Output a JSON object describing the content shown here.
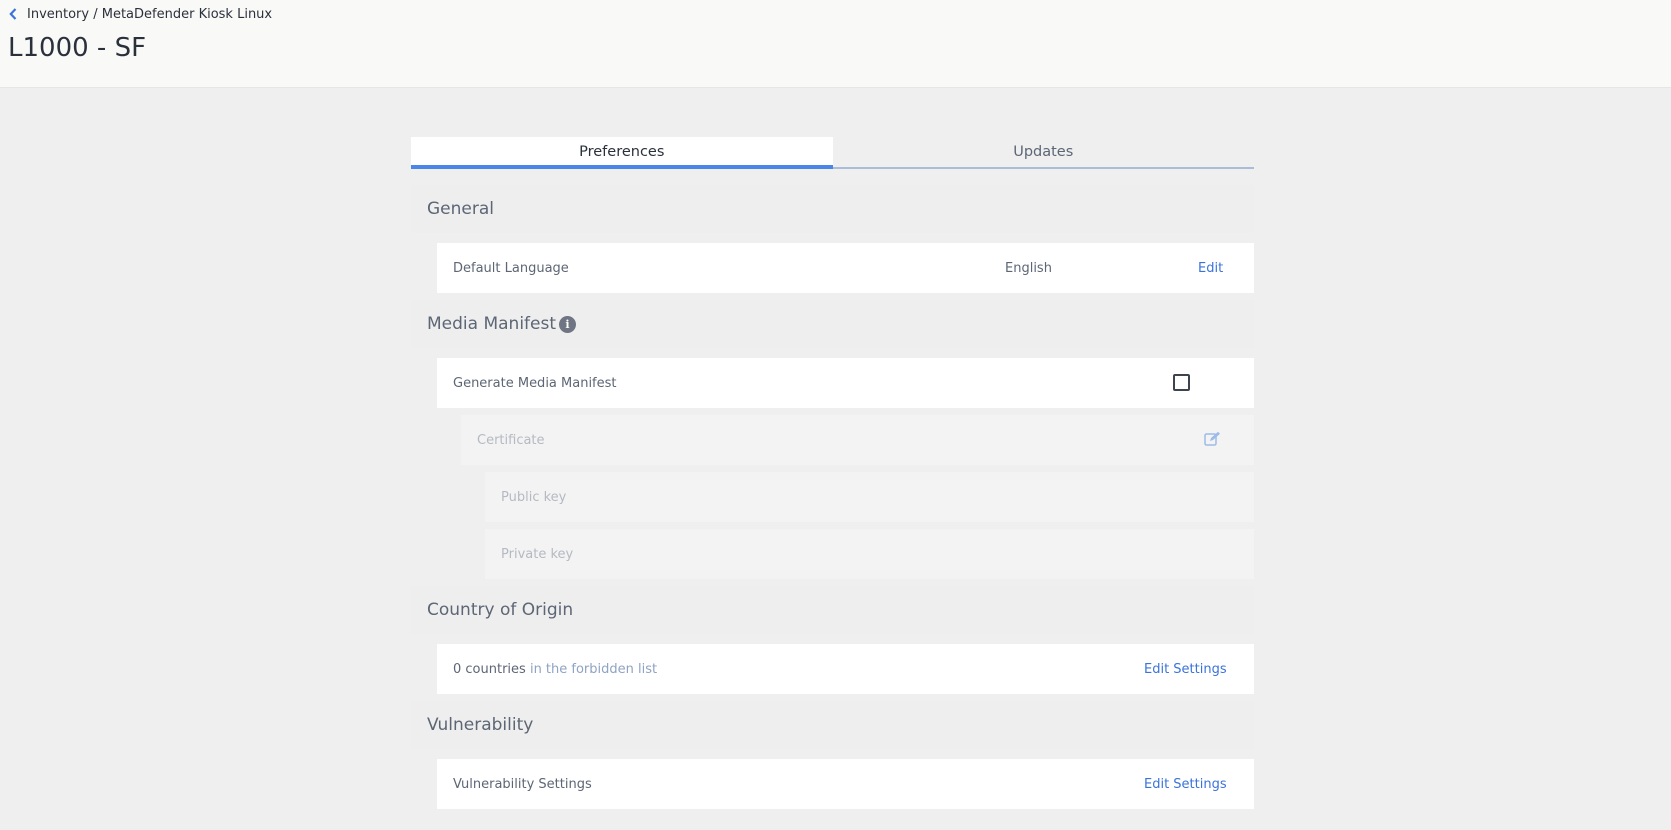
{
  "header": {
    "breadcrumb": "Inventory / MetaDefender Kiosk Linux",
    "title": "L1000 - SF"
  },
  "tabs": [
    {
      "label": "Preferences",
      "active": true
    },
    {
      "label": "Updates",
      "active": false
    }
  ],
  "general": {
    "heading": "General",
    "default_language_label": "Default Language",
    "default_language_value": "English",
    "edit_label": "Edit"
  },
  "media_manifest": {
    "heading": "Media Manifest",
    "info_icon": "info-icon",
    "generate_label": "Generate Media Manifest",
    "generate_checked": false,
    "certificate_label": "Certificate",
    "public_key_label": "Public key",
    "private_key_label": "Private key"
  },
  "country_of_origin": {
    "heading": "Country of Origin",
    "count_text": "0 countries",
    "suffix_text": "in the forbidden list",
    "edit_settings_label": "Edit Settings"
  },
  "vulnerability": {
    "heading": "Vulnerability",
    "settings_label": "Vulnerability Settings",
    "edit_settings_label": "Edit Settings"
  },
  "colors": {
    "accent": "#4a86e8",
    "link": "#3b73d9",
    "background": "#efefef"
  }
}
